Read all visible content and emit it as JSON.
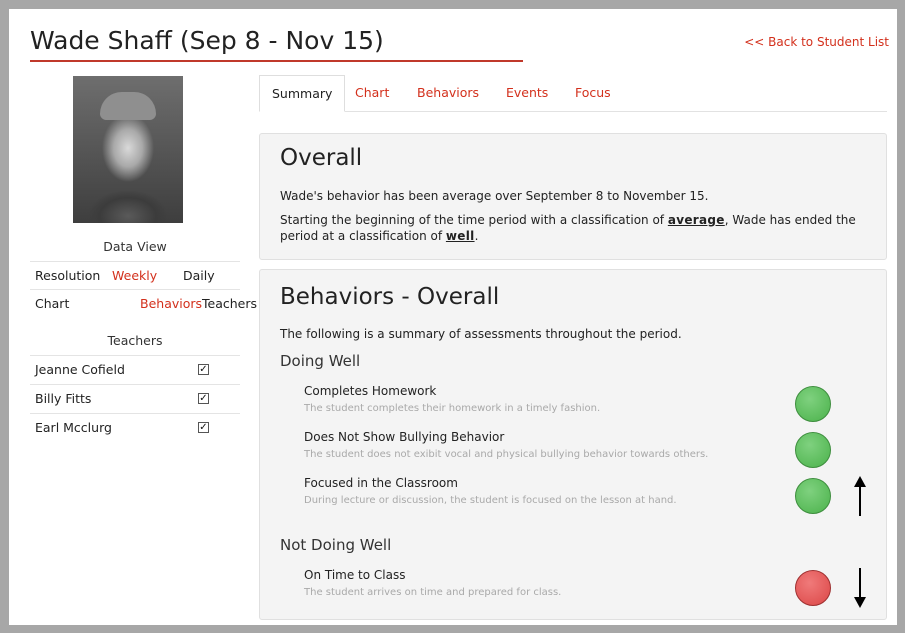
{
  "header": {
    "title": "Wade Shaff (Sep 8 - Nov 15)",
    "back_link": "<< Back to Student List"
  },
  "sidebar": {
    "data_view_heading": "Data View",
    "resolution": {
      "label": "Resolution",
      "selected": "Weekly",
      "other": "Daily"
    },
    "chart": {
      "label": "Chart",
      "selected": "Behaviors",
      "other": "Teachers"
    },
    "teachers_heading": "Teachers",
    "teachers": [
      {
        "name": "Jeanne Cofield",
        "checked": true
      },
      {
        "name": "Billy Fitts",
        "checked": true
      },
      {
        "name": "Earl Mcclurg",
        "checked": true
      }
    ]
  },
  "tabs": [
    {
      "label": "Summary",
      "active": true
    },
    {
      "label": "Chart",
      "active": false
    },
    {
      "label": "Behaviors",
      "active": false
    },
    {
      "label": "Events",
      "active": false
    },
    {
      "label": "Focus",
      "active": false
    }
  ],
  "overall": {
    "heading": "Overall",
    "line1": "Wade's behavior has been average over September 8 to November 15.",
    "line2_pre": "Starting the beginning of the time period with a classification of ",
    "start_class": "average",
    "line2_mid": ", Wade has ended the period at a classification of ",
    "end_class": "well",
    "line2_post": "."
  },
  "behaviors_overall": {
    "heading": "Behaviors - Overall",
    "intro": "The following is a summary of assessments throughout the period.",
    "doing_well_heading": "Doing Well",
    "doing_well": [
      {
        "title": "Completes Homework",
        "description": "The student completes their homework in a timely fashion.",
        "status": "good",
        "trend": "none"
      },
      {
        "title": "Does Not Show Bullying Behavior",
        "description": "The student does not exibit vocal and physical bullying behavior towards others.",
        "status": "good",
        "trend": "none"
      },
      {
        "title": "Focused in the Classroom",
        "description": "During lecture or discussion, the student is focused on the lesson at hand.",
        "status": "good",
        "trend": "up"
      }
    ],
    "not_doing_well_heading": "Not Doing Well",
    "not_doing_well": [
      {
        "title": "On Time to Class",
        "description": "The student arrives on time and prepared for class.",
        "status": "bad",
        "trend": "down"
      }
    ]
  },
  "colors": {
    "accent": "#d3301c",
    "good": "#4bb24b",
    "bad": "#db4646",
    "panel_bg": "#f4f4f4"
  }
}
